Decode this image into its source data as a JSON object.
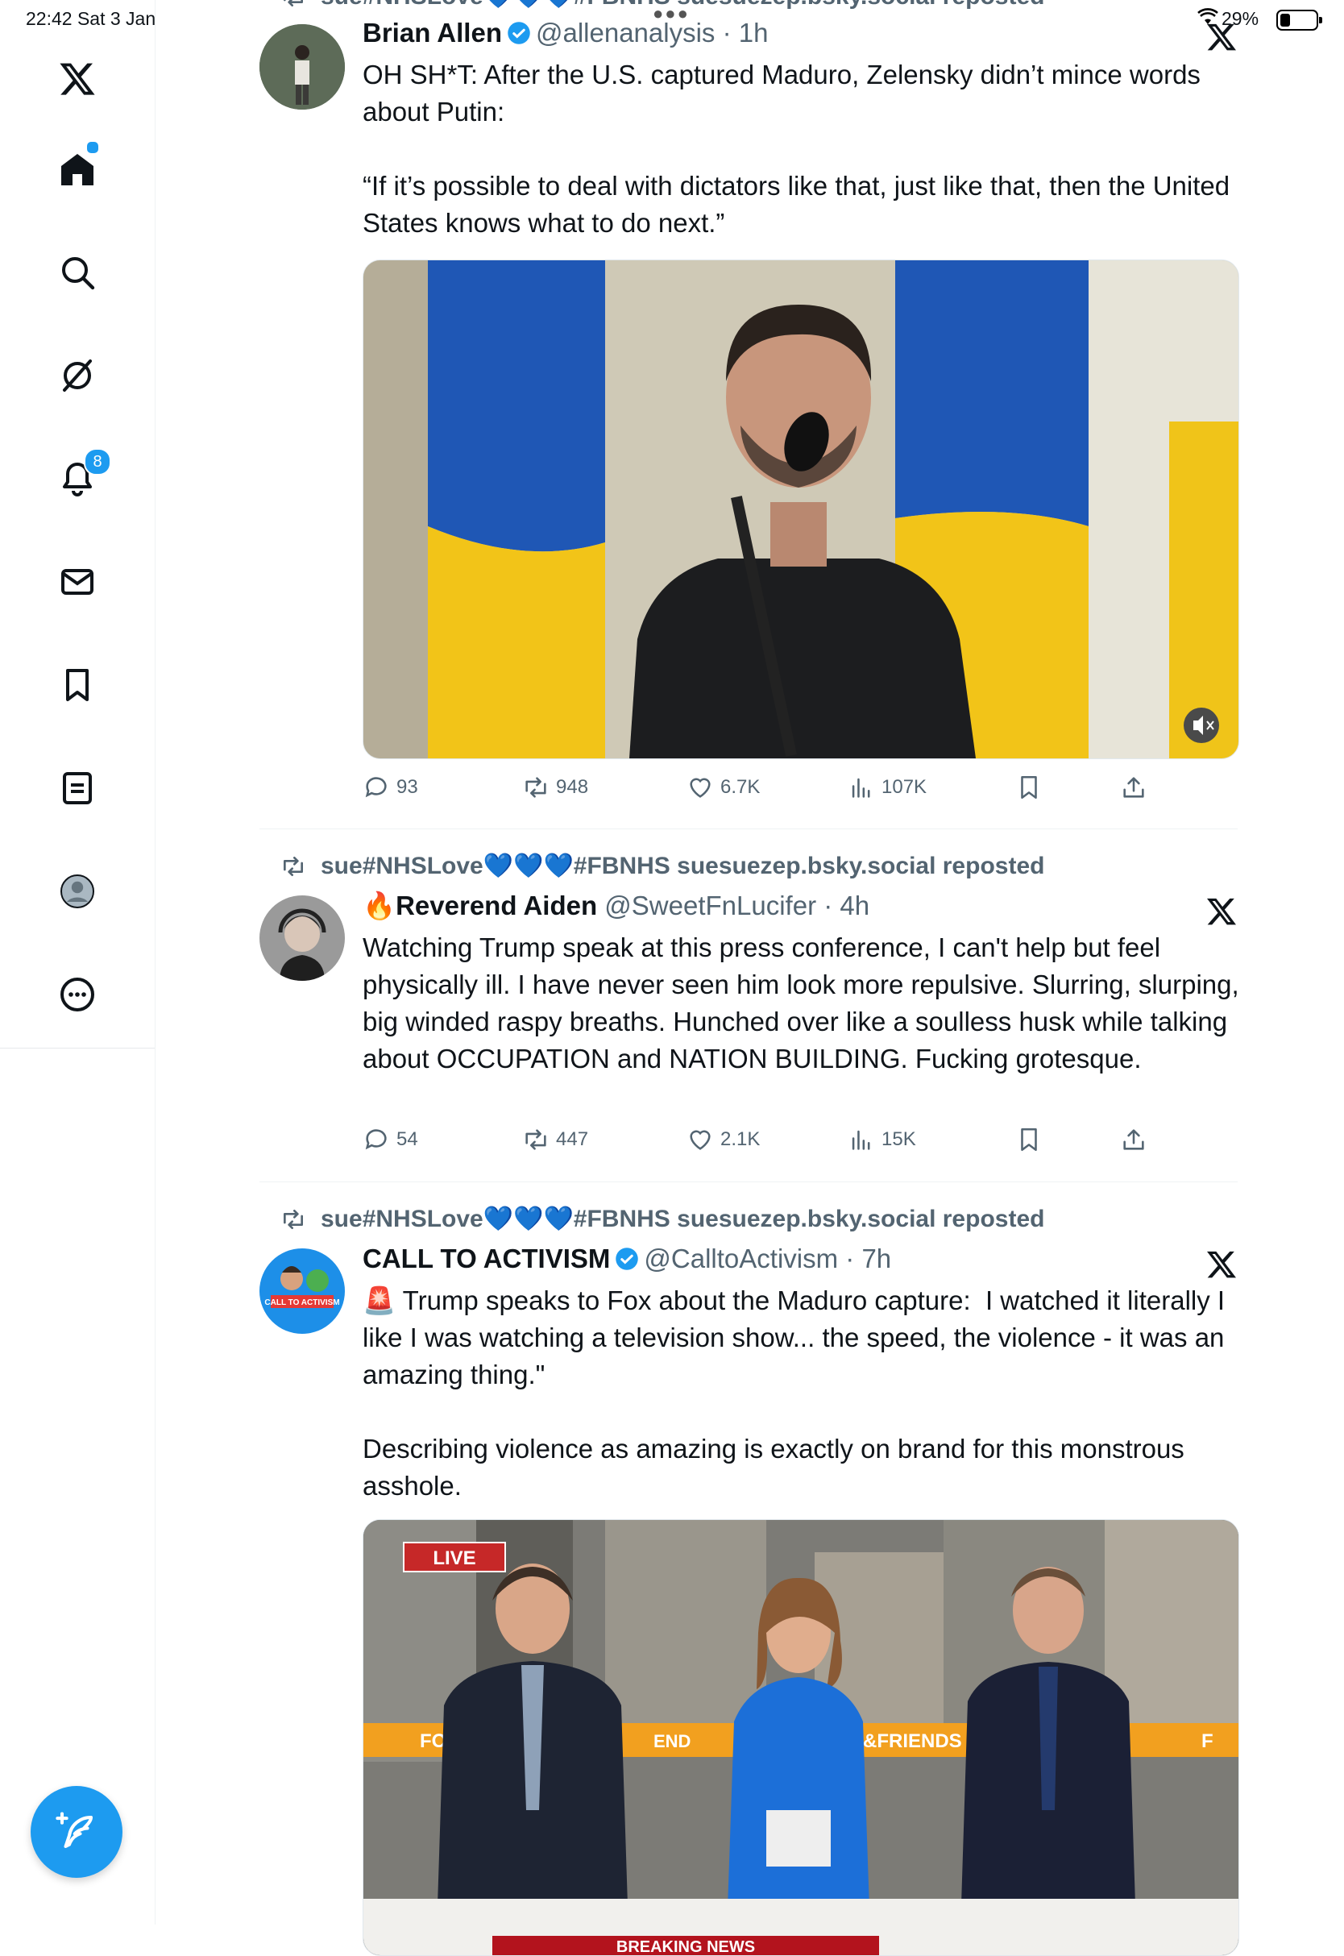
{
  "status_bar": {
    "time": "22:42  Sat 3 Jan",
    "battery": "29%"
  },
  "sidebar": {
    "notifications_badge": "8",
    "items": [
      "home",
      "search",
      "grok",
      "notifications",
      "messages",
      "bookmarks",
      "lists",
      "profile",
      "more"
    ]
  },
  "posts": [
    {
      "repost_line": "sue#NHSLove💙💙💙#FBNHS suesuezep.bsky.social reposted",
      "name": "Brian Allen",
      "handle": "@allenanalysis",
      "time": "· 1h",
      "text": "OH SH*T: After the U.S. captured Maduro, Zelensky didn’t mince words about Putin:\n\n“If it’s possible to deal with dictators like that, just like that, then the United States knows what to do next.”",
      "replies": "93",
      "reposts": "948",
      "likes": "6.7K",
      "views": "107K"
    },
    {
      "repost_line": "sue#NHSLove💙💙💙#FBNHS suesuezep.bsky.social reposted",
      "name_prefix": "🔥",
      "name": "Reverend Aiden",
      "handle": "@SweetFnLucifer",
      "time": "· 4h",
      "text": "Watching Trump speak at this press conference, I can't help but feel physically ill. I have never seen him look more repulsive. Slurring, slurping, big winded raspy breaths. Hunched over like a soulless husk while talking about OCCUPATION and NATION BUILDING. Fucking grotesque.",
      "replies": "54",
      "reposts": "447",
      "likes": "2.1K",
      "views": "15K"
    },
    {
      "repost_line": "sue#NHSLove💙💙💙#FBNHS suesuezep.bsky.social reposted",
      "name": "CALL TO ACTIVISM",
      "handle": "@CalltoActivism",
      "time": "· 7h",
      "text": "🚨 Trump speaks to Fox about the Maduro capture:  I watched it literally I like I was watching a television show... the speed, the violence - it was an amazing thing.\"\n\nDescribing violence as amazing is exactly on brand for this monstrous asshole.",
      "avatar_text": "CALL TO ACTIVISM",
      "media_labels": {
        "live": "LIVE",
        "banner_left": "FOX",
        "banner_mid": "END",
        "banner_right": "&FRIENDS",
        "banner_far": "F",
        "breaking": "BREAKING NEWS"
      }
    }
  ],
  "colors": {
    "accent": "#1d9bf0",
    "text": "#0f1419",
    "muted": "#536471"
  }
}
